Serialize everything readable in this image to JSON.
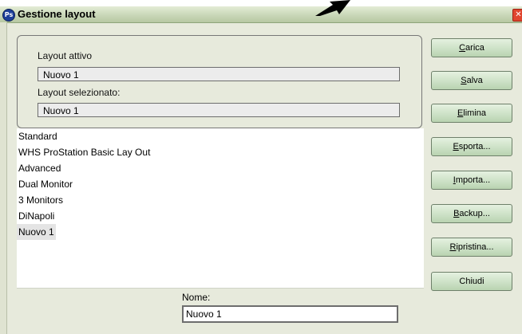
{
  "window": {
    "title": "Gestione layout",
    "app_icon_text": "Ps",
    "close_glyph": "✕"
  },
  "active_layout": {
    "label": "Layout attivo",
    "value": "Nuovo 1"
  },
  "selected_layout": {
    "label": "Layout selezionato:",
    "value": "Nuovo 1"
  },
  "layouts": [
    {
      "label": "Standard",
      "selected": false
    },
    {
      "label": "WHS ProStation Basic Lay Out",
      "selected": false
    },
    {
      "label": "Advanced",
      "selected": false
    },
    {
      "label": "Dual Monitor",
      "selected": false
    },
    {
      "label": "3 Monitors",
      "selected": false
    },
    {
      "label": "DiNapoli",
      "selected": false
    },
    {
      "label": "Nuovo 1",
      "selected": true
    }
  ],
  "buttons": {
    "carica": {
      "accel": "C",
      "rest": "arica"
    },
    "salva": {
      "accel": "S",
      "rest": "alva"
    },
    "elimina": {
      "accel": "E",
      "rest": "limina"
    },
    "esporta": {
      "accel": "E",
      "rest": "sporta..."
    },
    "importa": {
      "accel": "I",
      "rest": "mporta..."
    },
    "backup": {
      "accel": "B",
      "rest": "ackup..."
    },
    "ripristina": {
      "accel": "R",
      "rest": "ipristina..."
    },
    "chiudi": {
      "label": "Chiudi"
    }
  },
  "name_field": {
    "label": "Nome:",
    "value": "Nuovo 1"
  },
  "colors": {
    "window_bg": "#e7eadc",
    "titlebar": "#c9d7b8",
    "button": "#cfe3c9",
    "close": "#e0462f"
  }
}
